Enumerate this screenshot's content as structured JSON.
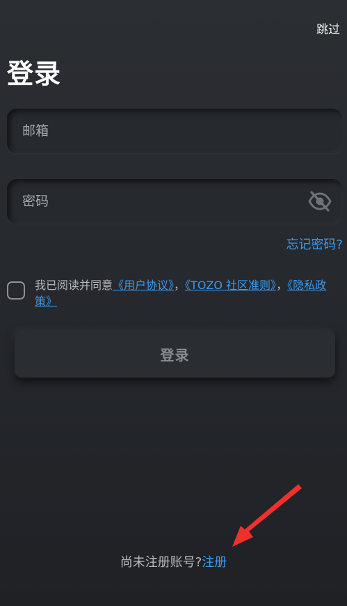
{
  "header": {
    "skip_label": "跳过",
    "title": "登录"
  },
  "form": {
    "email_placeholder": "邮箱",
    "password_placeholder": "密码",
    "forgot_label": "忘记密码?"
  },
  "agreement": {
    "prefix": "我已阅读并同意",
    "user_agreement": "《用户协议》",
    "sep1": "，",
    "community_rules": "《TOZO 社区准则》",
    "sep2": "，",
    "privacy_policy": "《隐私政策》"
  },
  "actions": {
    "login_label": "登录"
  },
  "footer": {
    "no_account": "尚未注册账号?",
    "register_label": "注册"
  },
  "colors": {
    "link": "#3a9bf0",
    "annotation_arrow": "#f0302b"
  },
  "icons": {
    "password_visibility": "eye-off-icon"
  }
}
